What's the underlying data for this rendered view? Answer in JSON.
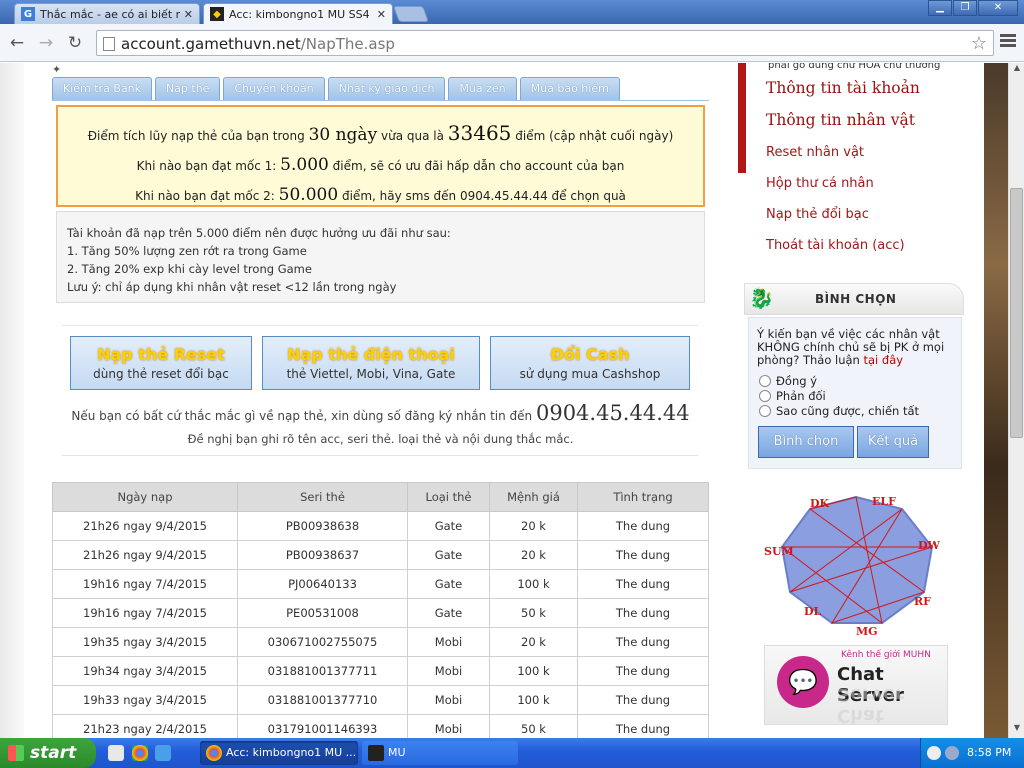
{
  "browser": {
    "tabs": [
      {
        "label": "Thắc mắc - ae có ai biết mốc",
        "icon": "g-icon"
      },
      {
        "label": "Acc: kimbongno1 MU SS4 SS6",
        "icon": "mu-icon"
      }
    ],
    "url_domain": "account.gamethuvn.net",
    "url_path": "/NapThe.asp"
  },
  "subtabs": [
    "Kiểm tra Bank",
    "Nạp thẻ",
    "Chuyển khoản",
    "Nhật ký giao dịch",
    "Mua zen",
    "Mua bảo hiểm"
  ],
  "points": {
    "line1_pre": "Điểm tích lũy nạp thẻ của bạn trong",
    "days": "30 ngày",
    "line1_mid": "vừa qua là",
    "total": "33465",
    "line1_post": "điểm (cập nhật cuối ngày)",
    "line2_pre": "Khi nào bạn đạt mốc 1:",
    "mark1": "5.000",
    "line2_post": "điểm, sẽ có ưu đãi hấp dẫn cho account của bạn",
    "line3_pre": "Khi nào bạn đạt mốc 2:",
    "mark2": "50.000",
    "line3_post": "điểm, hãy sms đến 0904.45.44.44 để chọn quà"
  },
  "benefits": {
    "intro": "Tài khoản đã nạp trên 5.000 điểm nên được hưởng ưu đãi như sau:",
    "items": [
      "1. Tăng 50% lượng zen rớt ra trong Game",
      "2. Tăng 20% exp khi cày level trong Game"
    ],
    "note": "Lưu ý: chỉ áp dụng khi nhân vật reset <12 lần trong ngày"
  },
  "actions": [
    {
      "title": "Nạp thẻ Reset",
      "sub": "dùng thẻ reset đổi bạc"
    },
    {
      "title": "Nạp thẻ điện thoại",
      "sub": "thẻ Viettel, Mobi, Vina, Gate"
    },
    {
      "title": "Đổi Cash",
      "sub": "sử dụng mua Cashshop"
    }
  ],
  "contact": {
    "text": "Nếu bạn có bất cứ thắc mắc gì về nạp thẻ, xin dùng số đăng ký nhắn tin đến",
    "phone": "0904.45.44.44",
    "note": "Đề nghị bạn ghi rõ tên acc, seri thẻ. loại thẻ và nội dung thắc mắc."
  },
  "history": {
    "headers": [
      "Ngày nạp",
      "Seri thẻ",
      "Loại thẻ",
      "Mệnh giá",
      "Tình trạng"
    ],
    "rows": [
      [
        "21h26 ngay 9/4/2015",
        "PB00938638",
        "Gate",
        "20 k",
        "The dung"
      ],
      [
        "21h26 ngay 9/4/2015",
        "PB00938637",
        "Gate",
        "20 k",
        "The dung"
      ],
      [
        "19h16 ngay 7/4/2015",
        "PJ00640133",
        "Gate",
        "100 k",
        "The dung"
      ],
      [
        "19h16 ngay 7/4/2015",
        "PE00531008",
        "Gate",
        "50 k",
        "The dung"
      ],
      [
        "19h35 ngay 3/4/2015",
        "030671002755075",
        "Mobi",
        "20 k",
        "The dung"
      ],
      [
        "19h34 ngay 3/4/2015",
        "031881001377711",
        "Mobi",
        "100 k",
        "The dung"
      ],
      [
        "19h33 ngay 3/4/2015",
        "031881001377710",
        "Mobi",
        "100 k",
        "The dung"
      ],
      [
        "21h23 ngay 2/4/2015",
        "031791001146393",
        "Mobi",
        "50 k",
        "The dung"
      ]
    ]
  },
  "sidebar": {
    "top_note": "phải gõ đúng chữ HOA chữ thường",
    "menu": [
      "Thông tin tài khoản",
      "Thông tin nhân vật",
      "Reset nhân vật",
      "Hộp thư cá nhân",
      "Nạp thẻ đổi bạc",
      "Thoát tài khoản (acc)"
    ],
    "poll": {
      "title": "BÌNH CHỌN",
      "question": "Ý kiến bạn về việc các nhân vật KHÔNG chính chủ sẽ bị PK ở mọi phòng? Thảo luận",
      "link": "tại đây",
      "options": [
        "Đồng ý",
        "Phản đối",
        "Sao cũng được, chiến tất"
      ],
      "vote": "Bình chọn",
      "result": "Kết quả"
    },
    "classes": [
      "DK",
      "ELF",
      "DW",
      "RF",
      "MG",
      "DL",
      "SUM"
    ],
    "chat": {
      "kenh": "Kênh thế giới MUHN",
      "label": "Chat Server"
    }
  },
  "taskbar": {
    "start": "start",
    "tasks": [
      "Acc: kimbongno1 MU ...",
      "MU"
    ],
    "clock": "8:58 PM"
  }
}
